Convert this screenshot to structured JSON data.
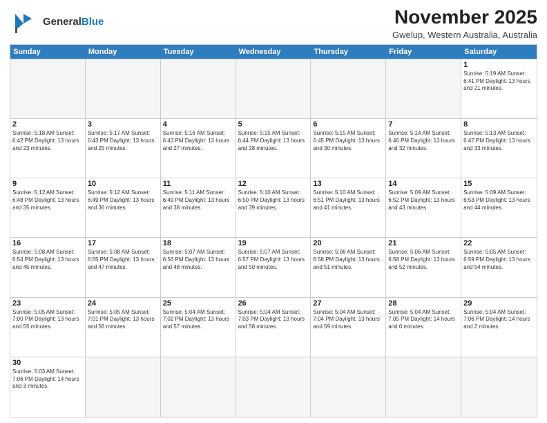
{
  "header": {
    "logo_general": "General",
    "logo_blue": "Blue",
    "month": "November 2025",
    "location": "Gwelup, Western Australia, Australia"
  },
  "day_headers": [
    "Sunday",
    "Monday",
    "Tuesday",
    "Wednesday",
    "Thursday",
    "Friday",
    "Saturday"
  ],
  "cells": [
    {
      "date": "",
      "info": "",
      "empty": true
    },
    {
      "date": "",
      "info": "",
      "empty": true
    },
    {
      "date": "",
      "info": "",
      "empty": true
    },
    {
      "date": "",
      "info": "",
      "empty": true
    },
    {
      "date": "",
      "info": "",
      "empty": true
    },
    {
      "date": "",
      "info": "",
      "empty": true
    },
    {
      "date": "1",
      "info": "Sunrise: 5:19 AM\nSunset: 6:41 PM\nDaylight: 13 hours\nand 21 minutes.",
      "empty": false
    },
    {
      "date": "2",
      "info": "Sunrise: 5:18 AM\nSunset: 6:42 PM\nDaylight: 13 hours\nand 23 minutes.",
      "empty": false
    },
    {
      "date": "3",
      "info": "Sunrise: 5:17 AM\nSunset: 6:43 PM\nDaylight: 13 hours\nand 25 minutes.",
      "empty": false
    },
    {
      "date": "4",
      "info": "Sunrise: 5:16 AM\nSunset: 6:43 PM\nDaylight: 13 hours\nand 27 minutes.",
      "empty": false
    },
    {
      "date": "5",
      "info": "Sunrise: 5:15 AM\nSunset: 6:44 PM\nDaylight: 13 hours\nand 28 minutes.",
      "empty": false
    },
    {
      "date": "6",
      "info": "Sunrise: 5:15 AM\nSunset: 6:45 PM\nDaylight: 13 hours\nand 30 minutes.",
      "empty": false
    },
    {
      "date": "7",
      "info": "Sunrise: 5:14 AM\nSunset: 6:46 PM\nDaylight: 13 hours\nand 32 minutes.",
      "empty": false
    },
    {
      "date": "8",
      "info": "Sunrise: 5:13 AM\nSunset: 6:47 PM\nDaylight: 13 hours\nand 33 minutes.",
      "empty": false
    },
    {
      "date": "9",
      "info": "Sunrise: 5:12 AM\nSunset: 6:48 PM\nDaylight: 13 hours\nand 35 minutes.",
      "empty": false
    },
    {
      "date": "10",
      "info": "Sunrise: 5:12 AM\nSunset: 6:49 PM\nDaylight: 13 hours\nand 36 minutes.",
      "empty": false
    },
    {
      "date": "11",
      "info": "Sunrise: 5:11 AM\nSunset: 6:49 PM\nDaylight: 13 hours\nand 38 minutes.",
      "empty": false
    },
    {
      "date": "12",
      "info": "Sunrise: 5:10 AM\nSunset: 6:50 PM\nDaylight: 13 hours\nand 39 minutes.",
      "empty": false
    },
    {
      "date": "13",
      "info": "Sunrise: 5:10 AM\nSunset: 6:51 PM\nDaylight: 13 hours\nand 41 minutes.",
      "empty": false
    },
    {
      "date": "14",
      "info": "Sunrise: 5:09 AM\nSunset: 6:52 PM\nDaylight: 13 hours\nand 43 minutes.",
      "empty": false
    },
    {
      "date": "15",
      "info": "Sunrise: 5:09 AM\nSunset: 6:53 PM\nDaylight: 13 hours\nand 44 minutes.",
      "empty": false
    },
    {
      "date": "16",
      "info": "Sunrise: 5:08 AM\nSunset: 6:54 PM\nDaylight: 13 hours\nand 45 minutes.",
      "empty": false
    },
    {
      "date": "17",
      "info": "Sunrise: 5:08 AM\nSunset: 6:55 PM\nDaylight: 13 hours\nand 47 minutes.",
      "empty": false
    },
    {
      "date": "18",
      "info": "Sunrise: 5:07 AM\nSunset: 6:56 PM\nDaylight: 13 hours\nand 48 minutes.",
      "empty": false
    },
    {
      "date": "19",
      "info": "Sunrise: 5:07 AM\nSunset: 6:57 PM\nDaylight: 13 hours\nand 50 minutes.",
      "empty": false
    },
    {
      "date": "20",
      "info": "Sunrise: 5:06 AM\nSunset: 6:58 PM\nDaylight: 13 hours\nand 51 minutes.",
      "empty": false
    },
    {
      "date": "21",
      "info": "Sunrise: 5:06 AM\nSunset: 6:58 PM\nDaylight: 13 hours\nand 52 minutes.",
      "empty": false
    },
    {
      "date": "22",
      "info": "Sunrise: 5:05 AM\nSunset: 6:59 PM\nDaylight: 13 hours\nand 54 minutes.",
      "empty": false
    },
    {
      "date": "23",
      "info": "Sunrise: 5:05 AM\nSunset: 7:00 PM\nDaylight: 13 hours\nand 55 minutes.",
      "empty": false
    },
    {
      "date": "24",
      "info": "Sunrise: 5:05 AM\nSunset: 7:01 PM\nDaylight: 13 hours\nand 56 minutes.",
      "empty": false
    },
    {
      "date": "25",
      "info": "Sunrise: 5:04 AM\nSunset: 7:02 PM\nDaylight: 13 hours\nand 57 minutes.",
      "empty": false
    },
    {
      "date": "26",
      "info": "Sunrise: 5:04 AM\nSunset: 7:03 PM\nDaylight: 13 hours\nand 58 minutes.",
      "empty": false
    },
    {
      "date": "27",
      "info": "Sunrise: 5:04 AM\nSunset: 7:04 PM\nDaylight: 13 hours\nand 59 minutes.",
      "empty": false
    },
    {
      "date": "28",
      "info": "Sunrise: 5:04 AM\nSunset: 7:05 PM\nDaylight: 14 hours\nand 0 minutes.",
      "empty": false
    },
    {
      "date": "29",
      "info": "Sunrise: 5:04 AM\nSunset: 7:06 PM\nDaylight: 14 hours\nand 2 minutes.",
      "empty": false
    },
    {
      "date": "30",
      "info": "Sunrise: 5:03 AM\nSunset: 7:06 PM\nDaylight: 14 hours\nand 3 minutes.",
      "empty": false
    },
    {
      "date": "",
      "info": "",
      "empty": true
    },
    {
      "date": "",
      "info": "",
      "empty": true
    },
    {
      "date": "",
      "info": "",
      "empty": true
    },
    {
      "date": "",
      "info": "",
      "empty": true
    },
    {
      "date": "",
      "info": "",
      "empty": true
    },
    {
      "date": "",
      "info": "",
      "empty": true
    }
  ]
}
